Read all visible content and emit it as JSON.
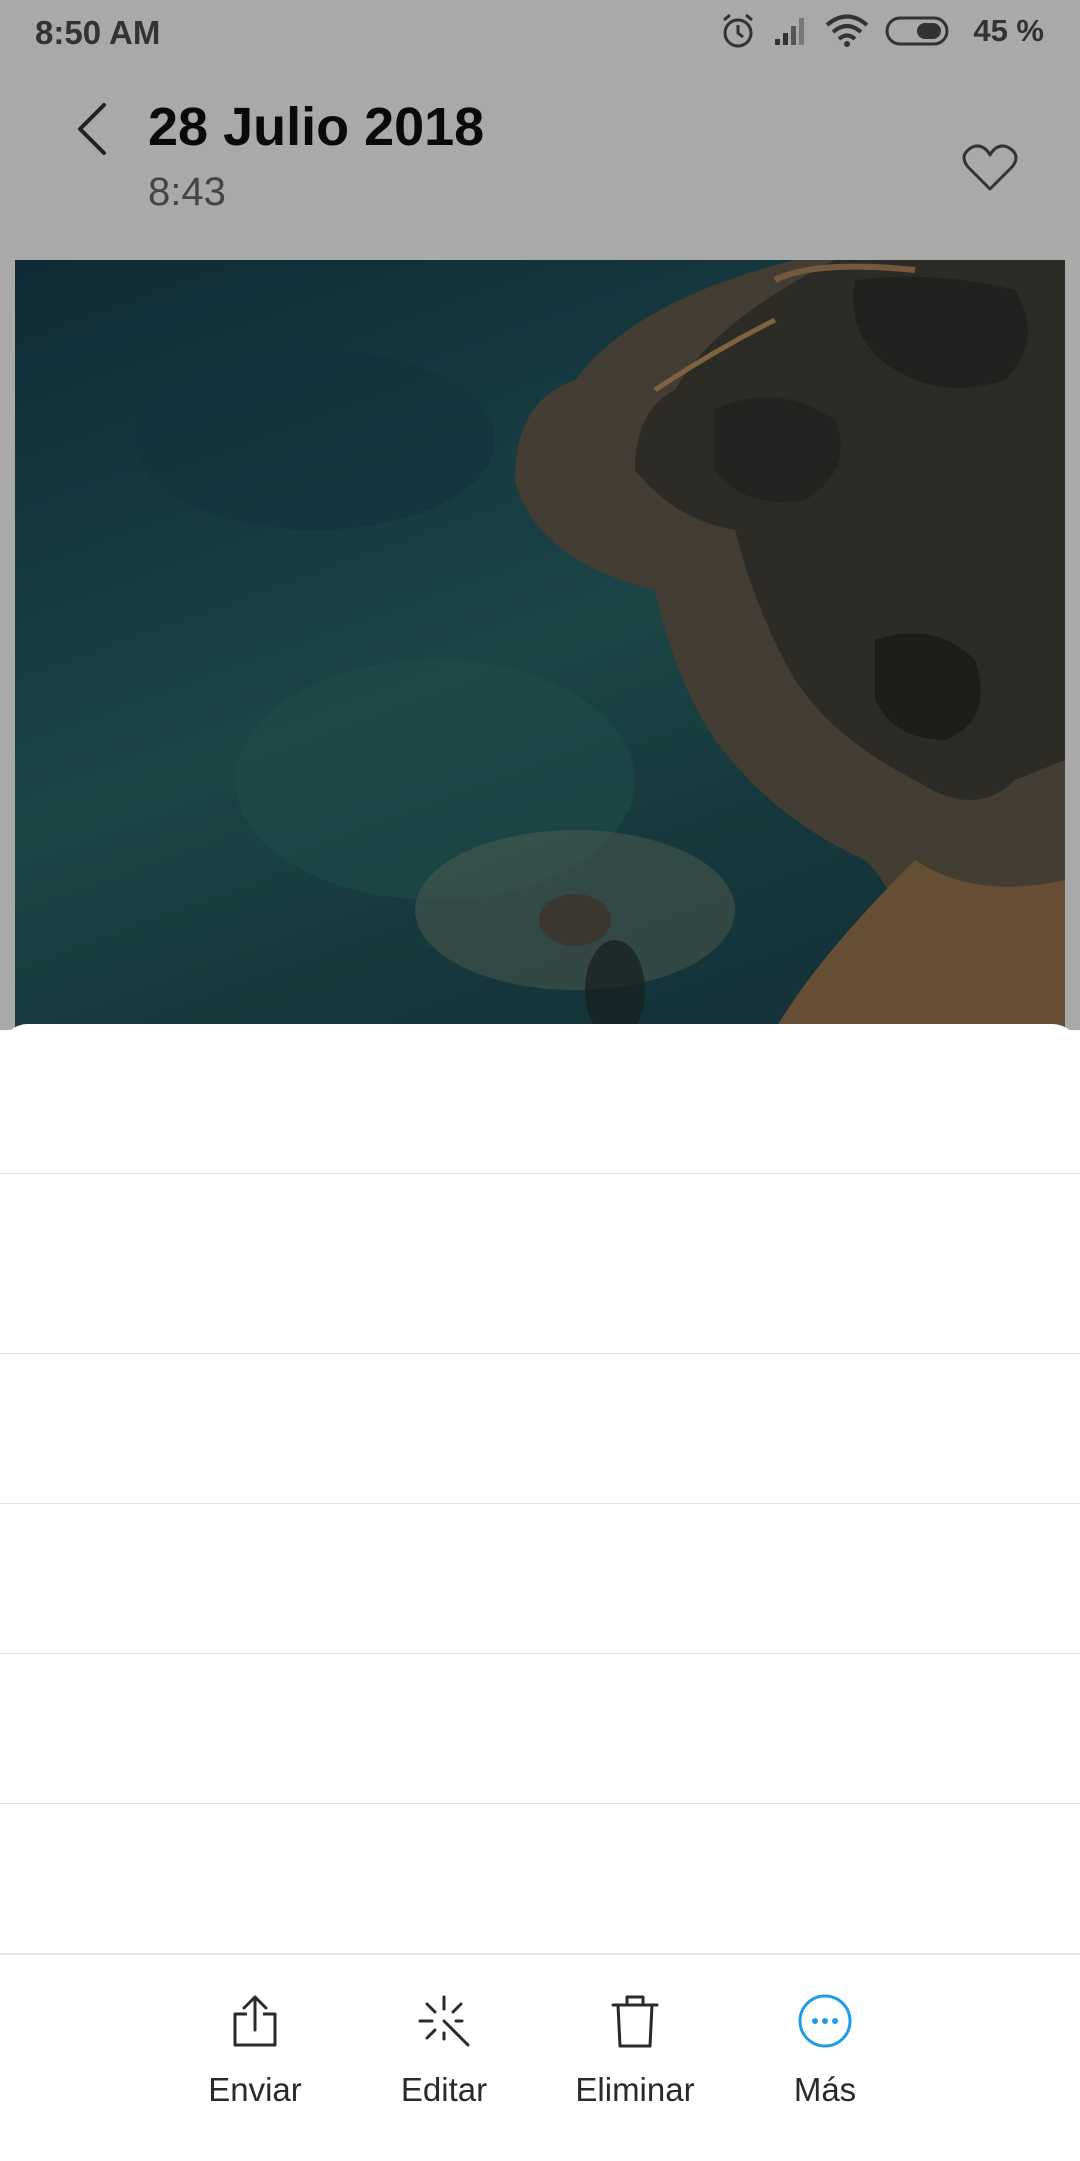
{
  "status_bar": {
    "time": "8:50 AM",
    "battery_text": "45 %",
    "icons": [
      "alarm-icon",
      "signal-icon",
      "wifi-icon",
      "battery-icon"
    ]
  },
  "header": {
    "title": "28 Julio 2018",
    "subtitle": "8:43",
    "back_icon": "back-arrow-icon",
    "favorite_icon": "heart-outline-icon"
  },
  "photo": {
    "description_icon": "photo"
  },
  "sheet": {
    "rows": [
      "",
      "",
      "",
      "",
      "",
      ""
    ]
  },
  "toolbar": {
    "items": [
      {
        "label": "Enviar",
        "icon": "share-icon"
      },
      {
        "label": "Editar",
        "icon": "magic-wand-icon"
      },
      {
        "label": "Eliminar",
        "icon": "trash-icon"
      },
      {
        "label": "Más",
        "icon": "more-icon"
      }
    ]
  },
  "colors": {
    "accent": "#1e9be9",
    "dim_background": "#a9a9a9"
  }
}
